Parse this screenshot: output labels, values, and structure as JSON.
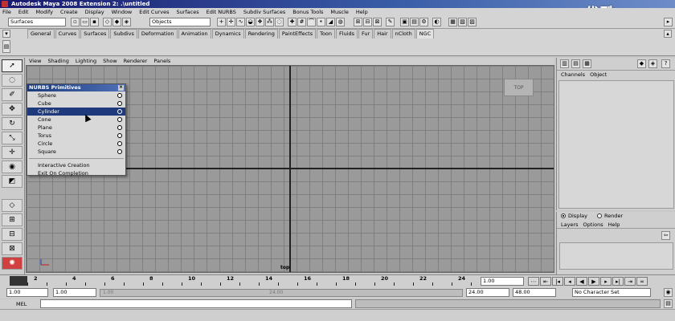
{
  "window": {
    "title": "Autodesk Maya 2008 Extension 2: .\\untitled"
  },
  "watermark": "优酷",
  "menubar": [
    "File",
    "Edit",
    "Modify",
    "Create",
    "Display",
    "Window",
    "Edit Curves",
    "Surfaces",
    "Edit NURBS",
    "Subdiv Surfaces",
    "Bonus Tools",
    "Muscle",
    "Help"
  ],
  "status": {
    "menu_set": "Surfaces",
    "selection_mode": "Objects"
  },
  "shelf": {
    "tabs": [
      "General",
      "Curves",
      "Surfaces",
      "Subdivs",
      "Deformation",
      "Animation",
      "Dynamics",
      "Rendering",
      "PaintEffects",
      "Toon",
      "Fluids",
      "Fur",
      "Hair",
      "nCloth",
      "NGC"
    ],
    "active_tab": "NGC"
  },
  "panel": {
    "menu": [
      "View",
      "Shading",
      "Lighting",
      "Show",
      "Renderer",
      "Panels"
    ],
    "camera_label": "TOP",
    "origin_label": "top"
  },
  "nurbs_menu": {
    "title": "NURBS Primitives",
    "items": [
      "Sphere",
      "Cube",
      "Cylinder",
      "Cone",
      "Plane",
      "Torus",
      "Circle",
      "Square"
    ],
    "highlighted": "Cylinder",
    "extra": [
      "Interactive Creation",
      "Exit On Completion"
    ]
  },
  "channel_box": {
    "menu": [
      "Channels",
      "Object"
    ]
  },
  "layer_editor": {
    "modes": [
      "Display",
      "Render"
    ],
    "selected_mode": "Display",
    "menu": [
      "Layers",
      "Options",
      "Help"
    ]
  },
  "time_slider": {
    "ticks": [
      "2",
      "4",
      "6",
      "8",
      "10",
      "12",
      "14",
      "16",
      "18",
      "20",
      "22",
      "24"
    ],
    "current_frame": "1.00"
  },
  "range": {
    "start": "1.00",
    "playback_start": "1.00",
    "range_start_label": "1.00",
    "range_end_label": "24.00",
    "playback_end": "24.00",
    "end": "48.00",
    "character_set": "No Character Set"
  },
  "command_line": {
    "label": "MEL"
  }
}
